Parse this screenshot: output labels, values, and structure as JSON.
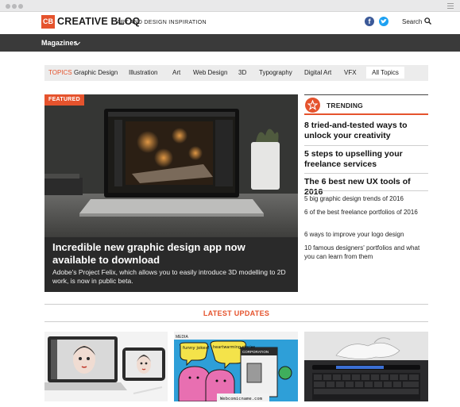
{
  "header": {
    "logo_badge": "CB",
    "logo_text": "CREATIVE BLOQ",
    "tagline": "ART AND DESIGN INSPIRATION",
    "facebook_glyph": "f",
    "search_label": "Search"
  },
  "nav": {
    "magazines_label": "Magazines"
  },
  "topics": {
    "label": "TOPICS",
    "items": [
      "Graphic Design",
      "Illustration",
      "Art",
      "Web Design",
      "3D",
      "Typography",
      "Digital Art",
      "VFX"
    ],
    "all_label": "All Topics"
  },
  "featured": {
    "badge": "FEATURED",
    "title": "Incredible new graphic design app now available to download",
    "description": "Adobe's Project Felix, which allows you to easily introduce 3D modelling to 2D work, is now in public beta."
  },
  "trending": {
    "label": "TRENDING",
    "big_items": [
      "8 tried-and-tested ways to unlock your creativity",
      "5 steps to upselling your freelance services",
      "The 6 best new UX tools of 2016"
    ],
    "small_items": [
      "5 big graphic design trends of 2016",
      "6 of the best freelance portfolios of 2016",
      "6 ways to improve your logo design",
      "10 famous designers' portfolios and what you can learn from them"
    ]
  },
  "latest": {
    "title": "LATEST UPDATES",
    "comic": {
      "tag": "MEDIA",
      "bubble_left": "funny jokes!",
      "bubble_right": "heartwarming stories",
      "box_label": "CORPORATION",
      "footer": "Webcomicname.com"
    }
  },
  "colors": {
    "accent": "#e5532d",
    "nav_bg": "#3a3a3a",
    "facebook": "#3b5998",
    "twitter": "#1da1f2"
  }
}
